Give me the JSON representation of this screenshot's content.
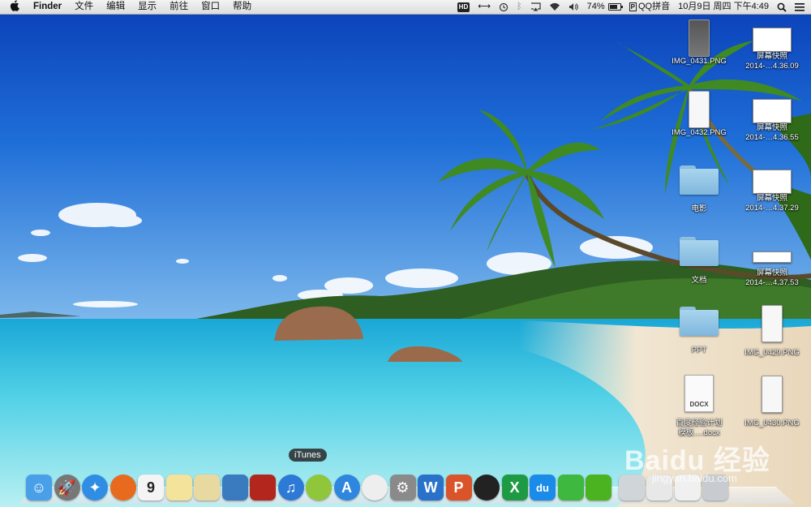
{
  "menubar": {
    "app_name": "Finder",
    "menus": [
      "文件",
      "编辑",
      "显示",
      "前往",
      "窗口",
      "帮助"
    ],
    "status": {
      "hd_label": "HD",
      "battery_percent": "74%",
      "battery_level": 0.74,
      "input_method": "QQ拼音",
      "input_badge": "P",
      "datetime": "10月9日 周四 下午4:49"
    }
  },
  "desktop_icons": [
    {
      "label": "IMG_0431.PNG",
      "label2": "",
      "kind": "phone-dark"
    },
    {
      "label": "屏幕快照",
      "label2": "2014-…4.36.09",
      "kind": "shot"
    },
    {
      "label": "IMG_0432.PNG",
      "label2": "",
      "kind": "phone"
    },
    {
      "label": "屏幕快照",
      "label2": "2014-…4.36.55",
      "kind": "shot"
    },
    {
      "label": "电影",
      "label2": "",
      "kind": "folder"
    },
    {
      "label": "屏幕快照",
      "label2": "2014-…4.37.29",
      "kind": "shot"
    },
    {
      "label": "文档",
      "label2": "",
      "kind": "folder"
    },
    {
      "label": "屏幕快照",
      "label2": "2014-…4.37.53",
      "kind": "shot-wide"
    },
    {
      "label": "PPT",
      "label2": "",
      "kind": "folder"
    },
    {
      "label": "IMG_0429.PNG",
      "label2": "",
      "kind": "phone"
    },
    {
      "label": "百度经验计划",
      "label2": "模板….docx",
      "kind": "doc",
      "badge": "DOCX"
    },
    {
      "label": "IMG_0430.PNG",
      "label2": "",
      "kind": "phone"
    }
  ],
  "dock": {
    "tooltip": "iTunes",
    "apps": [
      {
        "name": "finder-icon",
        "glyph": "☺",
        "color": "#4aa0e8"
      },
      {
        "name": "launchpad-icon",
        "glyph": "🚀",
        "color": "#777777"
      },
      {
        "name": "safari-icon",
        "glyph": "✦",
        "color": "#2f8de4"
      },
      {
        "name": "firefox-icon",
        "glyph": "",
        "color": "#e86a1e"
      },
      {
        "name": "calendar-icon",
        "glyph": "9",
        "color": "#f4f4f4"
      },
      {
        "name": "notes-icon",
        "glyph": "",
        "color": "#f4e39a"
      },
      {
        "name": "preview-icon",
        "glyph": "",
        "color": "#e8d9a0"
      },
      {
        "name": "iphoto-icon",
        "glyph": "",
        "color": "#3a7abf"
      },
      {
        "name": "photo-booth-icon",
        "glyph": "",
        "color": "#b3261e"
      },
      {
        "name": "itunes-icon",
        "glyph": "♫",
        "color": "#2d7ad6"
      },
      {
        "name": "music-app-icon",
        "glyph": "",
        "color": "#8fc63a"
      },
      {
        "name": "app-store-icon",
        "glyph": "A",
        "color": "#2e86de"
      },
      {
        "name": "migration-icon",
        "glyph": "",
        "color": "#eeeeee"
      },
      {
        "name": "system-preferences-icon",
        "glyph": "⚙",
        "color": "#8a8a8a"
      },
      {
        "name": "word-icon",
        "glyph": "W",
        "color": "#2a72c9"
      },
      {
        "name": "powerpoint-icon",
        "glyph": "P",
        "color": "#d9542b"
      },
      {
        "name": "qq-icon",
        "glyph": "",
        "color": "#222222"
      },
      {
        "name": "excel-icon",
        "glyph": "X",
        "color": "#1f9a44"
      },
      {
        "name": "baidu-cloud-icon",
        "glyph": "du",
        "color": "#1a8be8"
      },
      {
        "name": "wechat-icon",
        "glyph": "",
        "color": "#3fb83f"
      },
      {
        "name": "iqiyi-icon",
        "glyph": "",
        "color": "#4cb320"
      }
    ],
    "extras": [
      {
        "name": "downloads-stack-icon",
        "color": "#d0d5da"
      },
      {
        "name": "documents-stack-icon",
        "color": "#e8e8e8"
      },
      {
        "name": "screenshot-stack-icon",
        "color": "#f0f0f0"
      },
      {
        "name": "trash-icon",
        "color": "#c8ccd0"
      }
    ]
  },
  "watermark": {
    "text": "Baidu 经验",
    "url": "jingyan.baidu.com"
  }
}
